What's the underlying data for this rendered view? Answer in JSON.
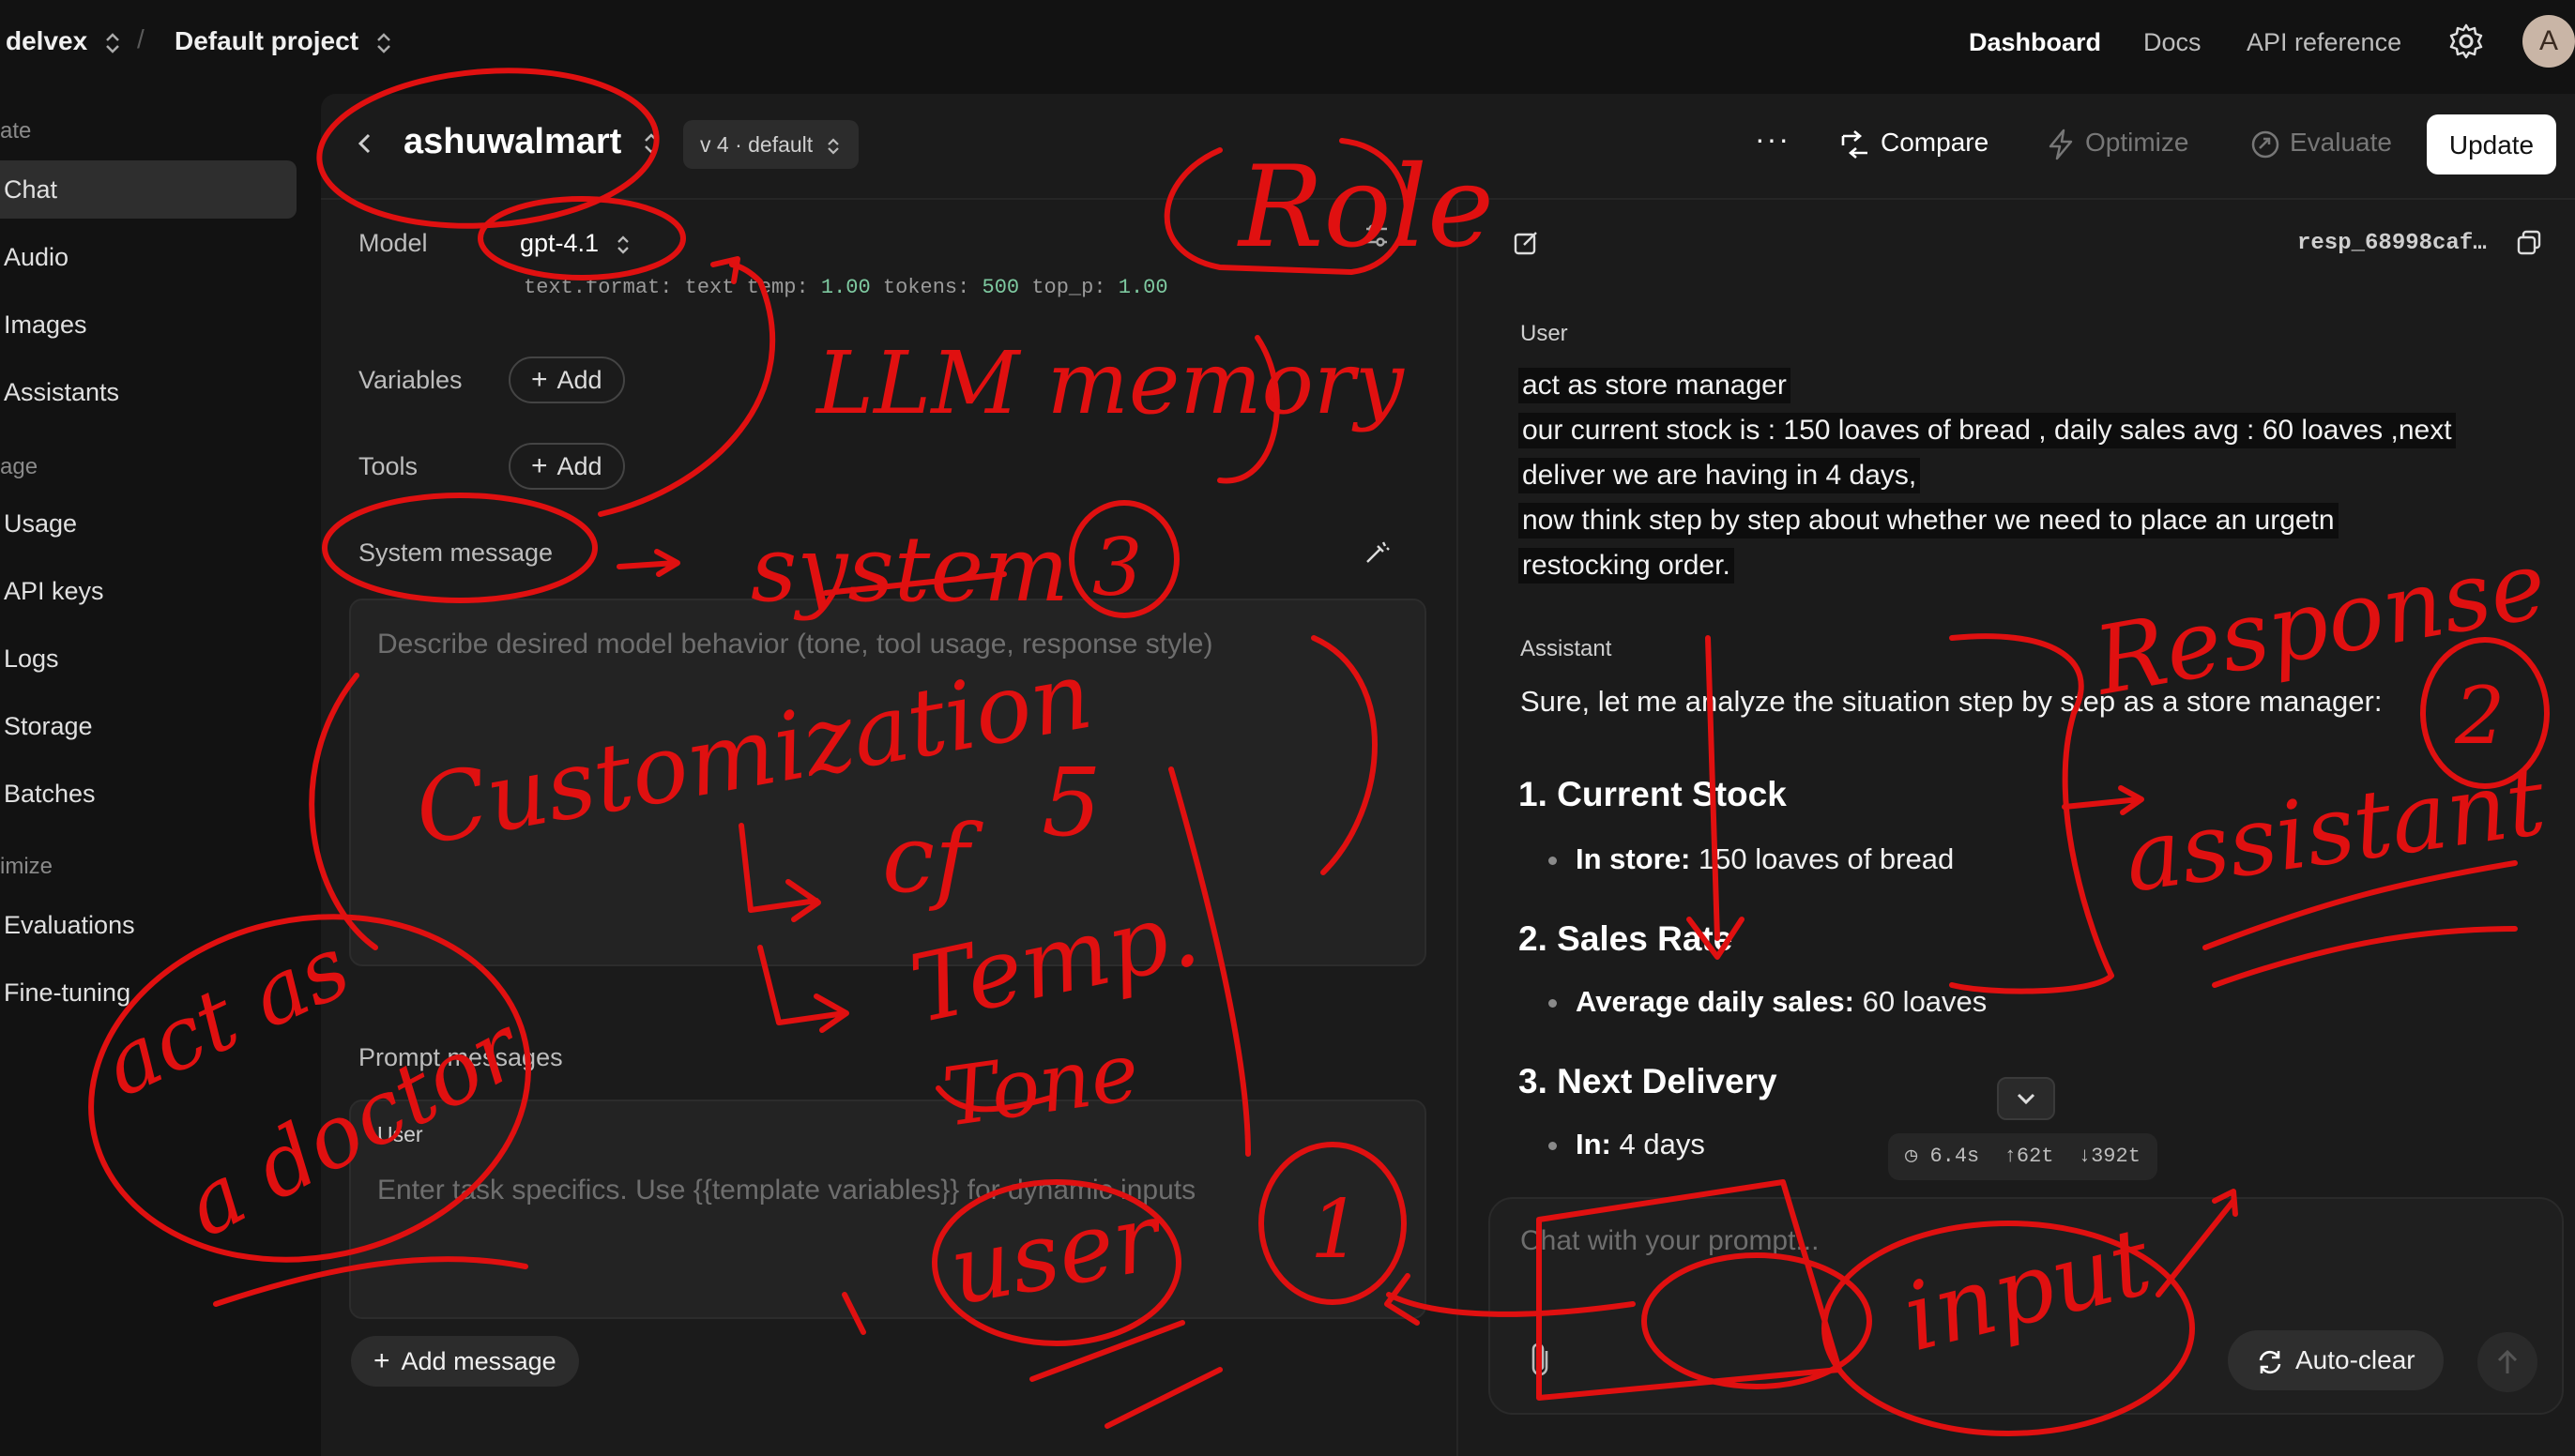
{
  "topbar": {
    "org": "delvex",
    "separator": "/",
    "project": "Default project",
    "nav": [
      "Dashboard",
      "Docs",
      "API reference"
    ],
    "avatar_initial": "A"
  },
  "sidebar": {
    "sections": [
      {
        "title": "ate",
        "items": [
          "Chat",
          "Audio",
          "Images",
          "Assistants"
        ]
      },
      {
        "title": "age",
        "items": [
          "Usage",
          "API keys",
          "Logs",
          "Storage",
          "Batches"
        ]
      },
      {
        "title": "imize",
        "items": [
          "Evaluations",
          "Fine-tuning"
        ]
      }
    ],
    "active_item": "Chat"
  },
  "header": {
    "prompt_name": "ashuwalmart",
    "version": "v 4 · default",
    "more": "···",
    "compare": "Compare",
    "optimize": "Optimize",
    "evaluate": "Evaluate",
    "update": "Update"
  },
  "config": {
    "model_label": "Model",
    "model_value": "gpt-4.1",
    "params": {
      "format_key": "text.format:",
      "format_val": "text",
      "temp_key": "temp:",
      "temp_val": "1.00",
      "tokens_key": "tokens:",
      "tokens_val": "500",
      "top_p_key": "top_p:",
      "top_p_val": "1.00"
    },
    "variables_label": "Variables",
    "tools_label": "Tools",
    "add_label": "Add",
    "system_label": "System message",
    "system_placeholder": "Describe desired model behavior (tone, tool usage, response style)",
    "prompt_messages_label": "Prompt messages",
    "user_role": "User",
    "user_placeholder": "Enter task specifics. Use {{template variables}} for dynamic inputs",
    "add_message": "Add message"
  },
  "chat": {
    "response_id": "resp_68998caf…",
    "user_role": "User",
    "user_lines": [
      "act as store manager",
      "our current stock is : 150 loaves of bread , daily sales avg : 60 loaves ,next",
      "deliver we are having in 4 days,",
      "now think step by step about whether we need to place an urgetn",
      "restocking order."
    ],
    "assistant_role": "Assistant",
    "assistant_intro": "Sure, let me analyze the situation step by step as a store manager:",
    "sections": [
      {
        "heading": "1. Current Stock",
        "bullet_label": "In store:",
        "bullet_value": " 150 loaves of bread"
      },
      {
        "heading": "2. Sales Rate",
        "bullet_label": "Average daily sales:",
        "bullet_value": " 60 loaves"
      },
      {
        "heading": "3. Next Delivery",
        "bullet_label": "In:",
        "bullet_value": " 4 days"
      }
    ],
    "stats": {
      "time": "6.4s",
      "in_tokens": "62t",
      "out_tokens": "392t"
    },
    "input_placeholder": "Chat with your prompt...",
    "auto_clear": "Auto-clear"
  },
  "annotations": {
    "role": "Role",
    "llm_memory": "LLM memory",
    "system": "system",
    "num3": "3",
    "customization": "Customization",
    "cf": "cf",
    "num5": "5",
    "temp": "Temp.",
    "tone": "Tone",
    "act_as": "act as",
    "a_doctor": "a doctor",
    "user": "user",
    "num1": "1",
    "response": "Response",
    "assistant": "assistant",
    "num2": "2",
    "input": "input",
    "color": "#e01010"
  }
}
